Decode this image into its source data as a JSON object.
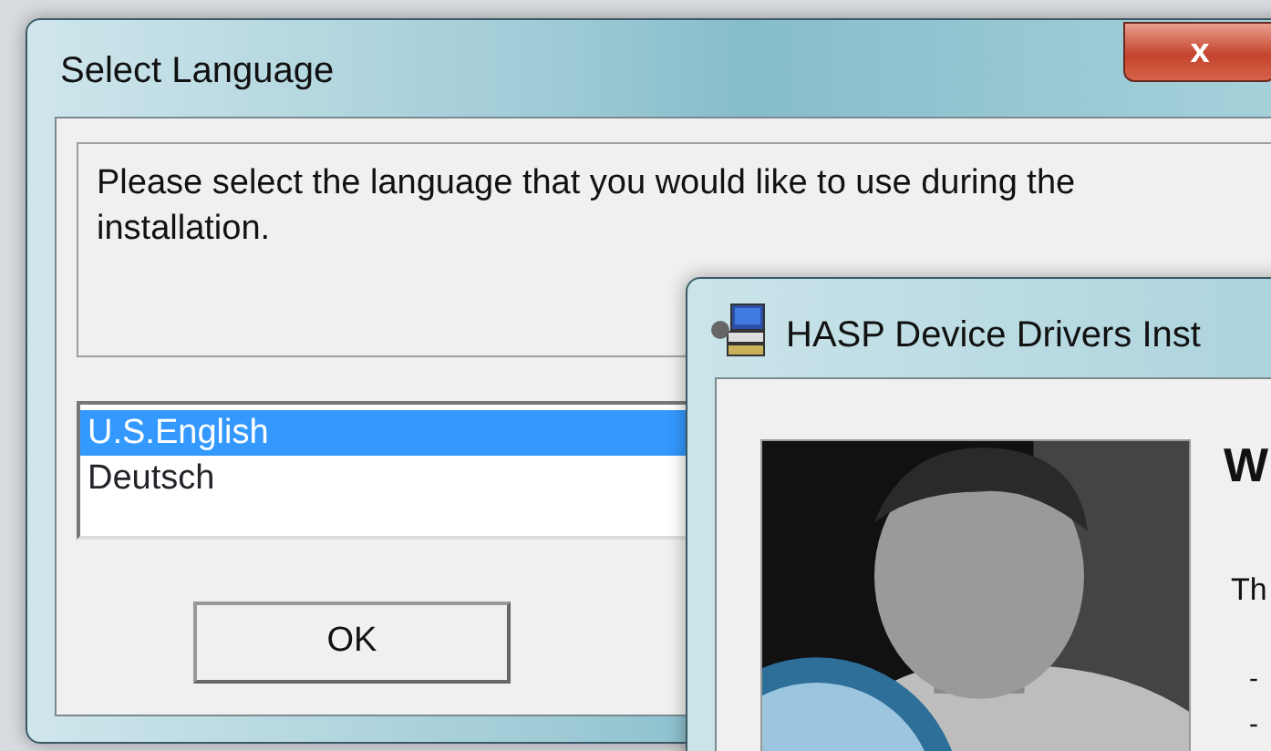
{
  "dialog": {
    "title": "Select Language",
    "close_label": "x",
    "message": "Please select the language that you would like to use during the installation.",
    "languages": [
      {
        "label": "U.S.English",
        "selected": true
      },
      {
        "label": "Deutsch",
        "selected": false
      }
    ],
    "button": "OK"
  },
  "installer": {
    "title": "HASP Device Drivers Inst",
    "heading": "W",
    "intro": "Th",
    "bullets": [
      "-",
      "-"
    ]
  }
}
